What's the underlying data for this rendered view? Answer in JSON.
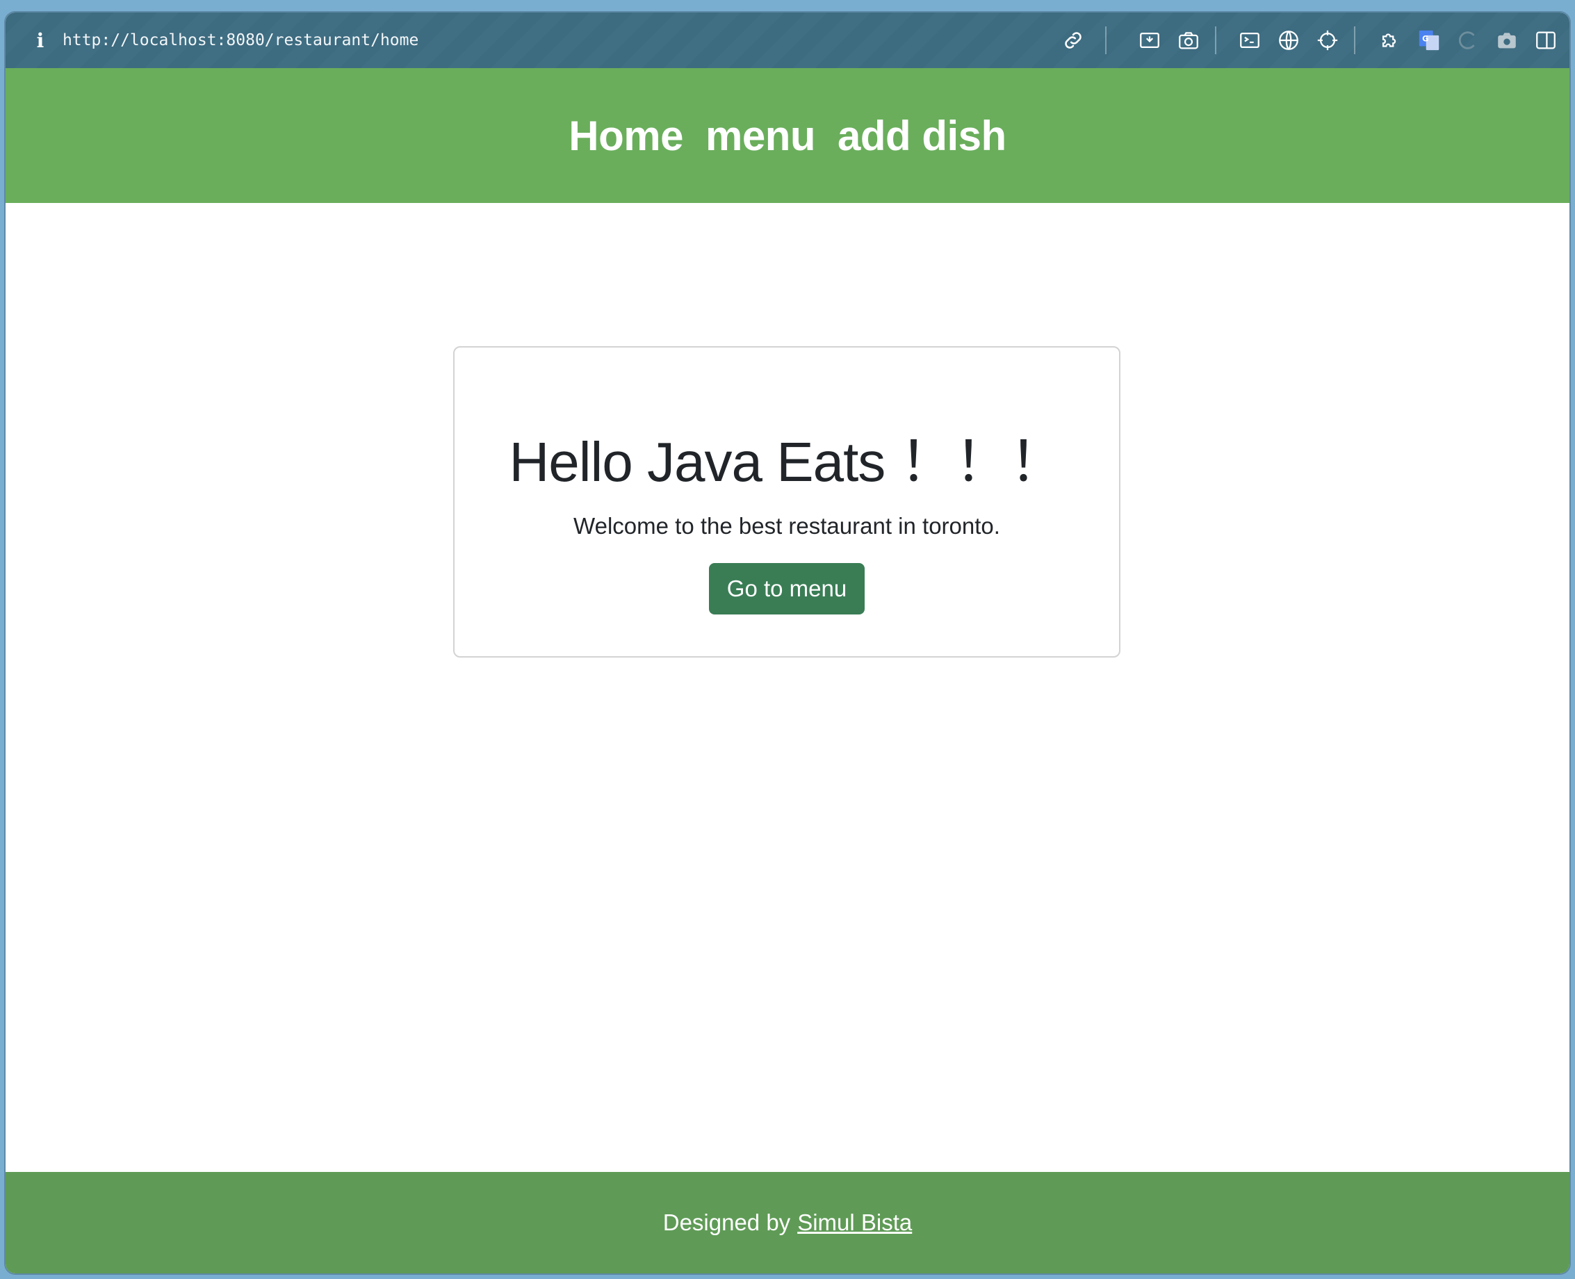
{
  "browser": {
    "url": "http://localhost:8080/restaurant/home",
    "icons": [
      "info-icon",
      "link-icon",
      "screenshot-area-icon",
      "camera-icon",
      "terminal-icon",
      "globe-icon",
      "crosshair-icon",
      "extension-icon",
      "translate-icon",
      "loading-icon",
      "camera-alt-icon",
      "sidebar-icon"
    ]
  },
  "nav": {
    "home": "Home",
    "menu": "menu",
    "add_dish": "add dish"
  },
  "card": {
    "title": "Hello Java Eats ！！！",
    "subtitle": "Welcome to the best restaurant in toronto.",
    "button": "Go to menu"
  },
  "footer": {
    "prefix": "Designed by",
    "author": "Simul Bista"
  },
  "colors": {
    "header": "#6aae5c",
    "footer": "#5f9b56",
    "button": "#3a7d55",
    "toolbar": "#3d6b80"
  }
}
